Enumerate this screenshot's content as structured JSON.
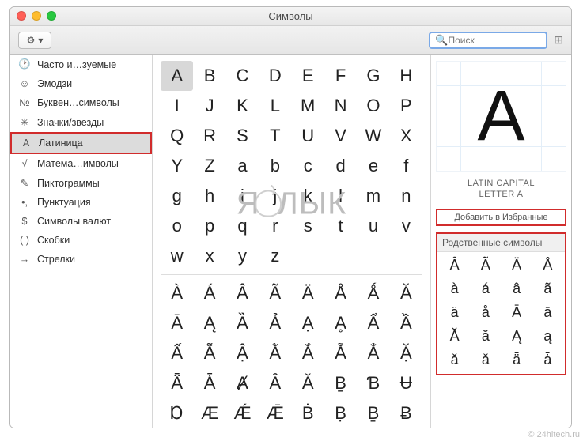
{
  "window": {
    "title": "Символы"
  },
  "search": {
    "placeholder": "Поиск"
  },
  "sidebar": {
    "items": [
      {
        "icon": "🕑",
        "label": "Часто и…зуемые"
      },
      {
        "icon": "☺",
        "label": "Эмодзи"
      },
      {
        "icon": "№",
        "label": "Буквен…символы"
      },
      {
        "icon": "✳",
        "label": "Значки/звезды"
      },
      {
        "icon": "A",
        "label": "Латиница",
        "selected": true,
        "highlight": true
      },
      {
        "icon": "√",
        "label": "Матема…имволы"
      },
      {
        "icon": "✎",
        "label": "Пиктограммы"
      },
      {
        "icon": "•,",
        "label": "Пунктуация"
      },
      {
        "icon": "$",
        "label": "Символы валют"
      },
      {
        "icon": "( )",
        "label": "Скобки"
      },
      {
        "icon": "→",
        "label": "Стрелки"
      }
    ]
  },
  "grid": {
    "selected_index": 0,
    "main": [
      [
        "A",
        "B",
        "C",
        "D",
        "E",
        "F",
        "G",
        "H"
      ],
      [
        "I",
        "J",
        "K",
        "L",
        "M",
        "N",
        "O",
        "P"
      ],
      [
        "Q",
        "R",
        "S",
        "T",
        "U",
        "V",
        "W",
        "X"
      ],
      [
        "Y",
        "Z",
        "a",
        "b",
        "c",
        "d",
        "e",
        "f"
      ],
      [
        "g",
        "h",
        "i",
        "j",
        "k",
        "l",
        "m",
        "n"
      ],
      [
        "o",
        "p",
        "q",
        "r",
        "s",
        "t",
        "u",
        "v"
      ],
      [
        "w",
        "x",
        "y",
        "z",
        "",
        "",
        "",
        ""
      ]
    ],
    "accented": [
      [
        "À",
        "Á",
        "Â",
        "Ã",
        "Ä",
        "Å",
        "Ǻ",
        "Ă"
      ],
      [
        "Ā",
        "Ą",
        "Ȁ",
        "Ả",
        "Ạ",
        "Ḁ",
        "Ẩ",
        "Ầ"
      ],
      [
        "Ấ",
        "Ẫ",
        "Ậ",
        "Ằ",
        "Ắ",
        "Ẵ",
        "Ẳ",
        "Ặ"
      ],
      [
        "Ǟ",
        "Ǡ",
        "Ⱥ",
        "Ȃ",
        "Ǎ",
        "Ḇ",
        "Ɓ",
        "Ʉ"
      ],
      [
        "Ɒ",
        "Æ",
        "Ǽ",
        "Ǣ",
        "Ḃ",
        "Ḅ",
        "Ḇ",
        "Ƀ"
      ]
    ]
  },
  "detail": {
    "preview_char": "A",
    "name_line1": "LATIN CAPITAL",
    "name_line2": "LETTER A",
    "add_favorites": "Добавить в Избранные",
    "related_title": "Родственные символы",
    "related_chars": [
      "Â",
      "Ã",
      "Ä",
      "Å",
      "à",
      "á",
      "â",
      "ã",
      "ä",
      "å",
      "Ā",
      "ā",
      "Ă",
      "ă",
      "Ą",
      "ą",
      "ǎ",
      "ǎ",
      "ǟ",
      "ǡ"
    ]
  },
  "watermark": {
    "left": "Я",
    "right": "ЛЫК"
  },
  "credit": "© 24hitech.ru"
}
